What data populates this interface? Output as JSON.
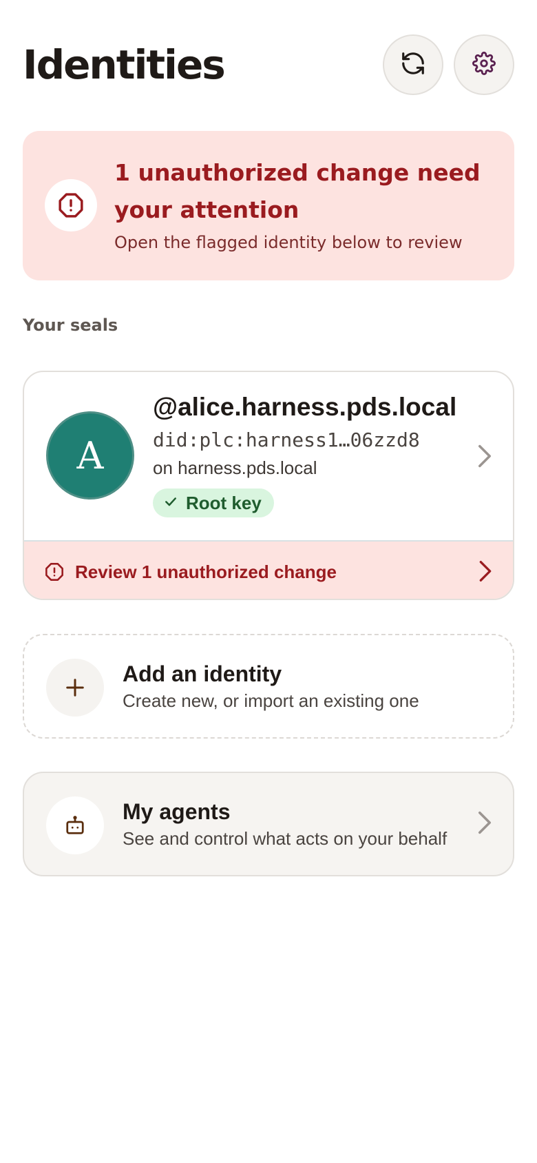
{
  "header": {
    "title": "Identities",
    "refresh_icon": "refresh-icon",
    "settings_icon": "gear-icon"
  },
  "alert": {
    "title": "1 unauthorized change need your attention",
    "subtitle": "Open the flagged identity below to review",
    "icon": "octagon-alert-icon"
  },
  "section": {
    "label": "Your seals"
  },
  "identity": {
    "avatar_letter": "A",
    "handle": "@alice.harness.pds.local",
    "did": "did:plc:harness1…06zzd8",
    "host": "on harness.pds.local",
    "badge": "Root key",
    "review_label": "Review 1 unauthorized change"
  },
  "add_identity": {
    "title": "Add an identity",
    "subtitle": "Create new, or import an existing one"
  },
  "agents": {
    "title": "My agents",
    "subtitle": "See and control what acts on your behalf"
  },
  "colors": {
    "alert_bg": "#fde3e0",
    "alert_text": "#9a1b1f",
    "avatar_bg": "#1f7f73",
    "badge_bg": "#d9f5df",
    "badge_text": "#1f5c2e"
  }
}
